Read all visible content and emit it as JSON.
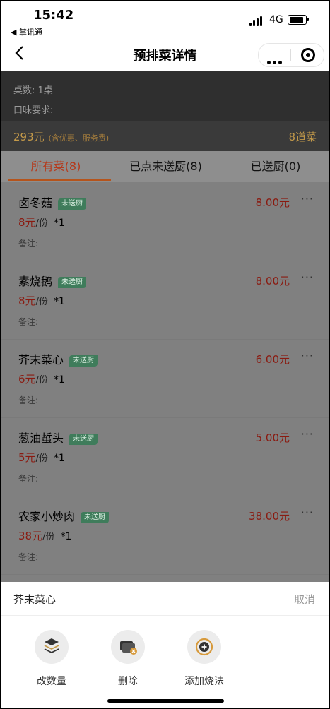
{
  "status_bar": {
    "time": "15:42",
    "back_app": "◀ 掌讯通",
    "network": "4G"
  },
  "nav": {
    "title": "预排菜详情"
  },
  "info": {
    "tables": "桌数: 1桌",
    "taste": "口味要求:"
  },
  "summary": {
    "price": "293元",
    "price_note": "(含优惠、服务费)",
    "count": "8道菜"
  },
  "tabs": [
    {
      "label": "所有菜(8)",
      "active": true
    },
    {
      "label": "已点未送厨(8)",
      "active": false
    },
    {
      "label": "已送厨(0)",
      "active": false
    }
  ],
  "dishes": [
    {
      "name": "卤冬菇",
      "badge": "未送厨",
      "unit_price": "8元",
      "per": "/份",
      "qty": "*1",
      "remark": "备注:",
      "total": "8.00元",
      "ops": "···"
    },
    {
      "name": "素烧鹅",
      "badge": "未送厨",
      "unit_price": "8元",
      "per": "/份",
      "qty": "*1",
      "remark": "备注:",
      "total": "8.00元",
      "ops": "···"
    },
    {
      "name": "芥末菜心",
      "badge": "未送厨",
      "unit_price": "6元",
      "per": "/份",
      "qty": "*1",
      "remark": "备注:",
      "total": "6.00元",
      "ops": "···"
    },
    {
      "name": "葱油蜇头",
      "badge": "未送厨",
      "unit_price": "5元",
      "per": "/份",
      "qty": "*1",
      "remark": "备注:",
      "total": "5.00元",
      "ops": "···"
    },
    {
      "name": "农家小炒肉",
      "badge": "未送厨",
      "unit_price": "38元",
      "per": "/份",
      "qty": "*1",
      "remark": "备注:",
      "total": "38.00元",
      "ops": "···"
    },
    {
      "name": "",
      "badge": "",
      "unit_price": "",
      "per": "",
      "qty": "",
      "remark": "",
      "total": "",
      "ops": ""
    }
  ],
  "action_sheet": {
    "title": "芥末菜心",
    "cancel": "取消",
    "actions": [
      {
        "label": "改数量",
        "icon": "layers-icon"
      },
      {
        "label": "删除",
        "icon": "delete-card-icon"
      },
      {
        "label": "添加烧法",
        "icon": "add-circle-icon"
      }
    ]
  },
  "colors": {
    "accent": "#b53a1c",
    "price": "#c49a4a",
    "badge": "#3f7c5b"
  }
}
